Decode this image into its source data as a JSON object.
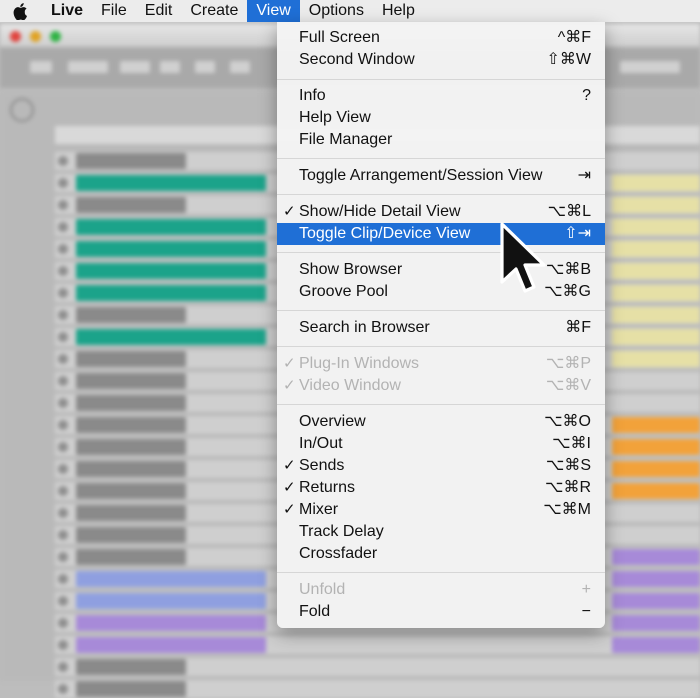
{
  "menubar": {
    "apple_icon": "apple-icon",
    "items": [
      "Live",
      "File",
      "Edit",
      "Create",
      "View",
      "Options",
      "Help"
    ],
    "active": "View"
  },
  "view_menu": {
    "items": [
      {
        "label": "Full Screen",
        "shortcut": "^⌘F"
      },
      {
        "label": "Second Window",
        "shortcut": "⇧⌘W"
      },
      {
        "label": "Info",
        "shortcut": "?"
      },
      {
        "label": "Help View",
        "shortcut": ""
      },
      {
        "label": "File Manager",
        "shortcut": ""
      },
      {
        "label": "Toggle Arrangement/Session View",
        "shortcut": "⇥"
      },
      {
        "label": "Show/Hide Detail View",
        "shortcut": "⌥⌘L",
        "checked": "✓"
      },
      {
        "label": "Toggle Clip/Device View",
        "shortcut": "⇧⇥"
      },
      {
        "label": "Show Browser",
        "shortcut": "⌥⌘B"
      },
      {
        "label": "Groove Pool",
        "shortcut": "⌥⌘G"
      },
      {
        "label": "Search in Browser",
        "shortcut": "⌘F"
      },
      {
        "label": "Plug-In Windows",
        "shortcut": "⌥⌘P",
        "checked": "✓"
      },
      {
        "label": "Video Window",
        "shortcut": "⌥⌘V",
        "checked": "✓"
      },
      {
        "label": "Overview",
        "shortcut": "⌥⌘O"
      },
      {
        "label": "In/Out",
        "shortcut": "⌥⌘I"
      },
      {
        "label": "Sends",
        "shortcut": "⌥⌘S",
        "checked": "✓"
      },
      {
        "label": "Returns",
        "shortcut": "⌥⌘R",
        "checked": "✓"
      },
      {
        "label": "Mixer",
        "shortcut": "⌥⌘M",
        "checked": "✓"
      },
      {
        "label": "Track Delay",
        "shortcut": ""
      },
      {
        "label": "Crossfader",
        "shortcut": ""
      },
      {
        "label": "Unfold",
        "shortcut": "+"
      },
      {
        "label": "Fold",
        "shortcut": "−"
      }
    ]
  },
  "colors": {
    "highlight": "#1f6fd6",
    "clip_teal": "#1ba38a",
    "clip_gray": "#8a8a8a",
    "clip_blue": "#8f9fe0",
    "clip_purple": "#a78ad8",
    "clip_orange": "#f2a23a",
    "clip_yellow": "#e6e0a6"
  }
}
